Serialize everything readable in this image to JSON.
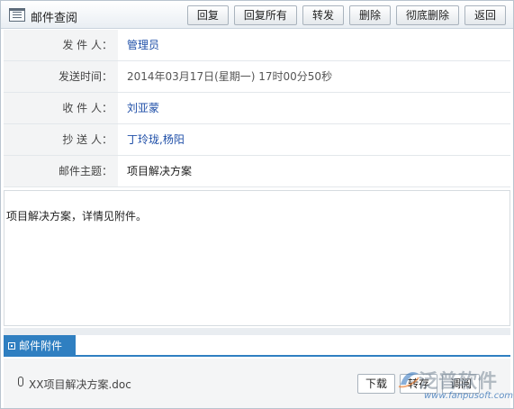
{
  "window": {
    "title": "邮件查阅"
  },
  "toolbar": {
    "reply": "回复",
    "reply_all": "回复所有",
    "forward": "转发",
    "delete": "删除",
    "delete_permanently": "彻底删除",
    "back": "返回"
  },
  "fields": {
    "sender": {
      "label": "发 件 人：",
      "value": "管理员"
    },
    "send_time": {
      "label": "发送时间：",
      "value": "2014年03月17日(星期一) 17时00分50秒"
    },
    "recipient": {
      "label": "收 件 人：",
      "value": "刘亚蒙"
    },
    "cc": {
      "label": "抄 送 人：",
      "value": "丁玲珑,杨阳"
    },
    "subject": {
      "label": "邮件主题：",
      "value": "项目解决方案"
    }
  },
  "body": {
    "text": "项目解决方案，详情见附件。"
  },
  "attachments": {
    "tab_label": "邮件附件",
    "files": [
      {
        "name": "XX项目解决方案.doc"
      }
    ],
    "actions": {
      "download": "下载",
      "forward": "转存",
      "view": "调阅"
    }
  },
  "watermark": {
    "brand": "泛普软件",
    "url": "www.fanpusoft.com"
  },
  "colors": {
    "accent": "#2f7fc1",
    "link_blue": "#1f4fa8"
  },
  "icons": {
    "title": "mail-list-icon",
    "attachment": "paperclip-icon"
  }
}
